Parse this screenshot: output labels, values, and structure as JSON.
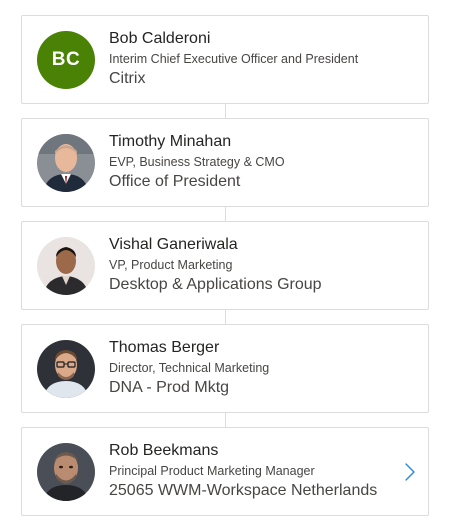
{
  "people": [
    {
      "initials": "BC",
      "name": "Bob Calderoni",
      "title": "Interim Chief Executive Officer and President",
      "department": "Citrix",
      "avatar_color": "#498205"
    },
    {
      "name": "Timothy Minahan",
      "title": "EVP, Business Strategy & CMO",
      "department": "Office of President"
    },
    {
      "name": "Vishal Ganeriwala",
      "title": "VP, Product Marketing",
      "department": "Desktop & Applications Group"
    },
    {
      "name": "Thomas Berger",
      "title": "Director, Technical Marketing",
      "department": "DNA - Prod Mktg"
    },
    {
      "name": "Rob Beekmans",
      "title": "Principal Product Marketing Manager",
      "department": "25065 WWM-Workspace Netherlands",
      "expand_icon": "chevron-right-icon"
    }
  ],
  "colors": {
    "chevron": "#2b88d8",
    "border": "#dcdcdc"
  }
}
